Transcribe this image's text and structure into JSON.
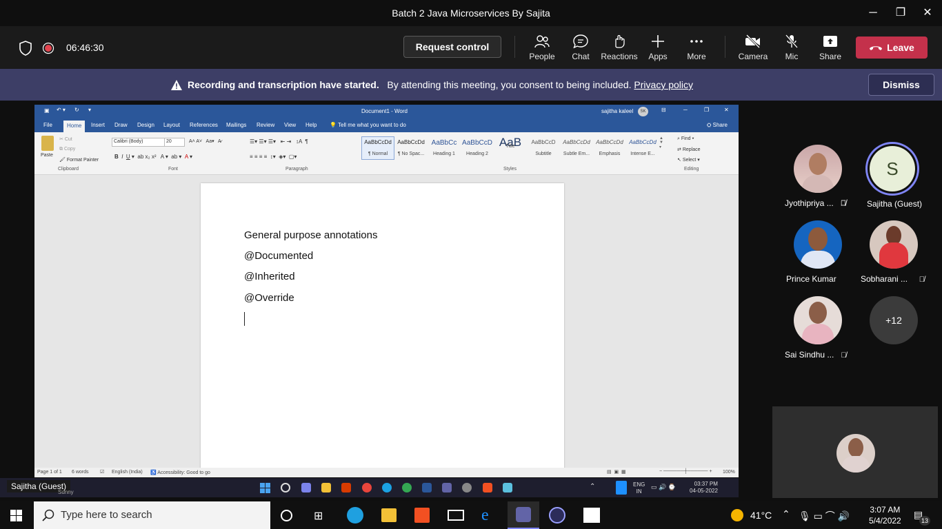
{
  "window": {
    "title": "Batch 2 Java Microservices By Sajita"
  },
  "toolbar": {
    "timer": "06:46:30",
    "request_control": "Request control",
    "items": {
      "people": "People",
      "chat": "Chat",
      "reactions": "Reactions",
      "apps": "Apps",
      "more": "More",
      "camera": "Camera",
      "mic": "Mic",
      "share": "Share"
    },
    "leave": "Leave"
  },
  "banner": {
    "bold": "Recording and transcription have started.",
    "text": "By attending this meeting, you consent to being included.",
    "link": "Privacy policy",
    "dismiss": "Dismiss"
  },
  "word": {
    "title": "Document1 - Word",
    "user": "sajitha kaleel",
    "user_initials": "SK",
    "share": "Share",
    "tell_me": "Tell me what you want to do",
    "tabs": [
      "File",
      "Home",
      "Insert",
      "Draw",
      "Design",
      "Layout",
      "References",
      "Mailings",
      "Review",
      "View",
      "Help"
    ],
    "clipboard": {
      "paste": "Paste",
      "cut": "Cut",
      "copy": "Copy",
      "format_painter": "Format Painter",
      "label": "Clipboard"
    },
    "font": {
      "name": "Calibri (Body)",
      "size": "20",
      "label": "Font"
    },
    "paragraph_label": "Paragraph",
    "styles": [
      {
        "preview": "AaBbCcDd",
        "name": "¶ Normal"
      },
      {
        "preview": "AaBbCcDd",
        "name": "¶ No Spac..."
      },
      {
        "preview": "AaBbCc",
        "name": "Heading 1"
      },
      {
        "preview": "AaBbCcD",
        "name": "Heading 2"
      },
      {
        "preview": "AaB",
        "name": "Title"
      },
      {
        "preview": "AaBbCcD",
        "name": "Subtitle"
      },
      {
        "preview": "AaBbCcDd",
        "name": "Subtle Em..."
      },
      {
        "preview": "AaBbCcDd",
        "name": "Emphasis"
      },
      {
        "preview": "AaBbCcDd",
        "name": "Intense E..."
      }
    ],
    "styles_label": "Styles",
    "editing": {
      "find": "Find",
      "replace": "Replace",
      "select": "Select",
      "label": "Editing"
    },
    "document_lines": [
      "General purpose annotations",
      "@Documented",
      "@Inherited",
      "@Override"
    ],
    "status": {
      "page": "Page 1 of 1",
      "words": "6 words",
      "language": "English (India)",
      "accessibility": "Accessibility: Good to go",
      "zoom": "100%"
    }
  },
  "inner_taskbar": {
    "presenter_label": "Sajitha (Guest)",
    "weather": "Sunny",
    "lang": "ENG",
    "region": "IN",
    "time": "03:37 PM",
    "date": "04-05-2022"
  },
  "participants": [
    {
      "name": "Jyothipriya ...",
      "muted": true
    },
    {
      "name": "Sajitha (Guest)",
      "initial": "S",
      "muted": false
    },
    {
      "name": "Prince Kumar",
      "muted": true
    },
    {
      "name": "Sobharani ...",
      "muted": true
    },
    {
      "name": "Sai Sindhu ...",
      "muted": true
    },
    {
      "name": "+12"
    }
  ],
  "taskbar": {
    "search_placeholder": "Type here to search",
    "temperature": "41°C",
    "time": "3:07 AM",
    "date": "5/4/2022",
    "notifications": "13"
  },
  "colors": {
    "leave": "#c4314b",
    "banner": "#3d3e66",
    "word_blue": "#2b579a",
    "record": "#e3444f"
  }
}
